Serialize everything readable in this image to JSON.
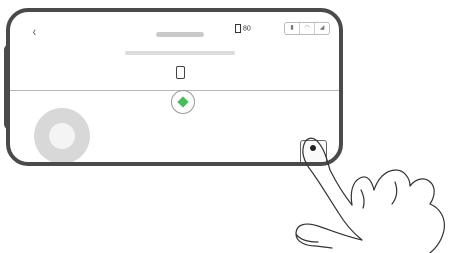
{
  "header": {
    "back_glyph": "‹",
    "battery": "80",
    "status_icons": [
      "remote-signal-icon",
      "wifi-icon",
      "signal-icon"
    ]
  },
  "controls": {
    "shutter_icon": "record-dot-icon",
    "joystick_icon": "joystick-icon"
  },
  "colors": {
    "frame": "#4a4a4a",
    "target_diamond": "#4cbb5a",
    "background": "#ffffff"
  }
}
